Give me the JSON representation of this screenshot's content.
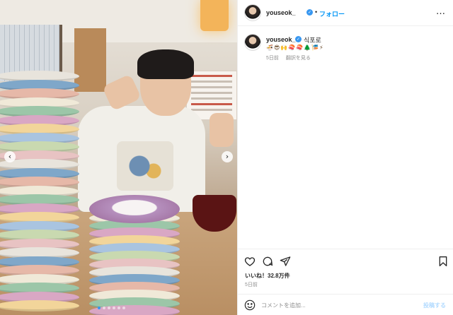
{
  "photo": {
    "carousel_prev_icon": "chevron-left-icon",
    "carousel_next_icon": "chevron-right-icon",
    "carousel_prev_glyph": "‹",
    "carousel_next_glyph": "›",
    "dot_count": 6,
    "active_dot_index": 0
  },
  "header": {
    "username": "youseok_",
    "verified_glyph": "✓",
    "separator": "•",
    "follow_label": "フォロー",
    "more_glyph": "…"
  },
  "caption": {
    "username": "youseok_",
    "text": "식포로",
    "emoji": "🍜😎🙌🍣🍣🌲🎏⚡",
    "time_ago": "5日前",
    "translate_label": "翻訳を見る"
  },
  "actions": {
    "like_icon": "heart-icon",
    "comment_icon": "comment-icon",
    "share_icon": "share-icon",
    "save_icon": "bookmark-icon"
  },
  "stats": {
    "likes": "いいね！32.8万件",
    "date": "5日前"
  },
  "comment": {
    "placeholder": "コメントを追加...",
    "post_label": "投稿する"
  },
  "colors": {
    "accent": "#0095f6",
    "post_disabled": "#b3dbff",
    "verified": "#3897f0"
  }
}
